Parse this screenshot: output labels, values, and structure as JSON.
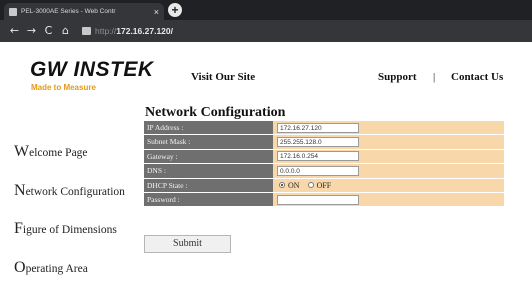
{
  "browser": {
    "tab_title": "PEL-3000AE Series - Web Contr",
    "tab_close": "×",
    "new_tab": "+",
    "nav_back": "←",
    "nav_forward": "→",
    "nav_reload": "C",
    "nav_home": "⌂",
    "address_scheme": "http://",
    "address_host": "172.16.27.120/"
  },
  "header": {
    "logo_text": "GW INSTEK",
    "tagline": "Made to Measure",
    "visit_site": "Visit Our Site",
    "support": "Support",
    "separator": "|",
    "contact": "Contact Us"
  },
  "sidenav": {
    "items": [
      {
        "cap": "W",
        "rest": "elcome Page"
      },
      {
        "cap": "N",
        "rest": "etwork Configuration"
      },
      {
        "cap": "F",
        "rest": "igure of Dimensions"
      },
      {
        "cap": "O",
        "rest": "perating Area"
      }
    ]
  },
  "form": {
    "title": "Network Configuration",
    "rows": [
      {
        "label": "IP Address :",
        "value": "172.16.27.120"
      },
      {
        "label": "Subnet Mask :",
        "value": "255.255.128.0"
      },
      {
        "label": "Gateway :",
        "value": "172.16.0.254"
      },
      {
        "label": "DNS :",
        "value": "0.0.0.0"
      },
      {
        "label": "DHCP State :",
        "on": "ON",
        "off": "OFF",
        "selected": "ON"
      },
      {
        "label": "Password :",
        "value": ""
      }
    ],
    "submit_label": "Submit"
  },
  "colors": {
    "label_bg": "#6f6f6f",
    "value_bg": "#f8d8aa",
    "brand_accent": "#e39a1f"
  }
}
